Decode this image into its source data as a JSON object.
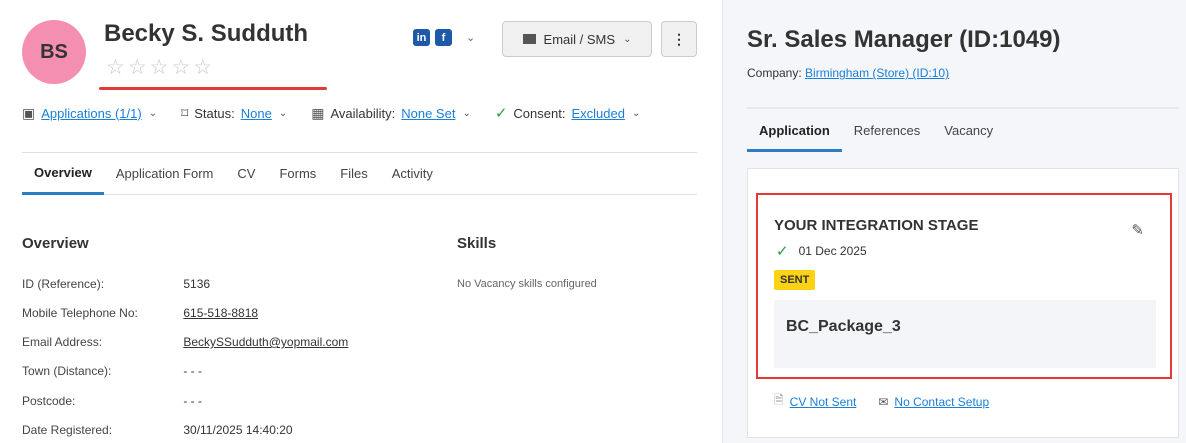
{
  "candidate": {
    "initials": "BS",
    "name": "Becky S. Sudduth",
    "rating_max": 5,
    "rating_value": 0,
    "social": {
      "linkedin": "in",
      "facebook": "f"
    },
    "email_btn_label": "Email / SMS",
    "more_label": "⋮"
  },
  "meta": {
    "applications_label": "Applications (1/1)",
    "status_label": "Status:",
    "status_value": "None",
    "availability_label": "Availability:",
    "availability_value": "None Set",
    "consent_label": "Consent:",
    "consent_value": "Excluded"
  },
  "left_tabs": [
    "Overview",
    "Application Form",
    "CV",
    "Forms",
    "Files",
    "Activity"
  ],
  "overview": {
    "title": "Overview",
    "rows": [
      {
        "label": "ID (Reference):",
        "value": "5136"
      },
      {
        "label": "Mobile Telephone No:",
        "value": "615-518-8818"
      },
      {
        "label": "Email Address:",
        "value": "BeckySSudduth@yopmail.com"
      },
      {
        "label": "Town (Distance):",
        "value": "- - -"
      },
      {
        "label": "Postcode:",
        "value": "- - -"
      },
      {
        "label": "Date Registered:",
        "value": "30/11/2025 14:40:20"
      }
    ]
  },
  "skills": {
    "title": "Skills",
    "empty_text": "No Vacancy skills configured"
  },
  "job": {
    "title": "Sr. Sales Manager (ID:1049)",
    "company_label": "Company:",
    "company_value": "Birmingham (Store) (ID:10)",
    "tabs": [
      "Application",
      "References",
      "Vacancy"
    ],
    "stage": {
      "title": "YOUR INTEGRATION STAGE",
      "date": "01 Dec 2025",
      "badge": "SENT",
      "package": "BC_Package_3"
    },
    "links": {
      "cv": "CV Not Sent",
      "contact": "No Contact Setup"
    }
  },
  "colors": {
    "avatar": "#f48fb1",
    "accent": "#2c7dc4",
    "highlight_red": "#e53935",
    "badge_yellow": "#fcd116",
    "link": "#1a7fd6"
  }
}
